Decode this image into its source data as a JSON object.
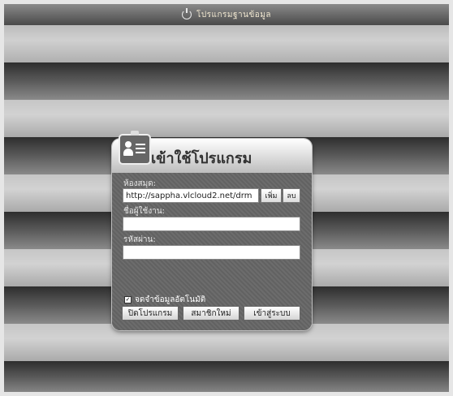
{
  "app": {
    "title": "โปรแกรมฐานข้อมูล"
  },
  "dialog": {
    "title": "เข้าใช้โปรแกรม",
    "room_label": "ห้องสมุด:",
    "room_value": "http://sappha.vlcloud2.net/drm",
    "add_label": "เพิ่ม",
    "delete_label": "ลบ",
    "username_label": "ชื่อผู้ใช้งาน:",
    "username_value": "",
    "password_label": "รหัสผ่าน:",
    "password_value": "",
    "remember_label": "จดจำข้อมูลอัตโนมัติ",
    "remember_checked": true,
    "close_label": "ปิดโปรแกรม",
    "register_label": "สมาชิกใหม่",
    "login_label": "เข้าสู่ระบบ"
  },
  "colors": {
    "band_dark": "#333333",
    "band_light": "#c4c4c4",
    "accent": "#6a6a6a"
  }
}
